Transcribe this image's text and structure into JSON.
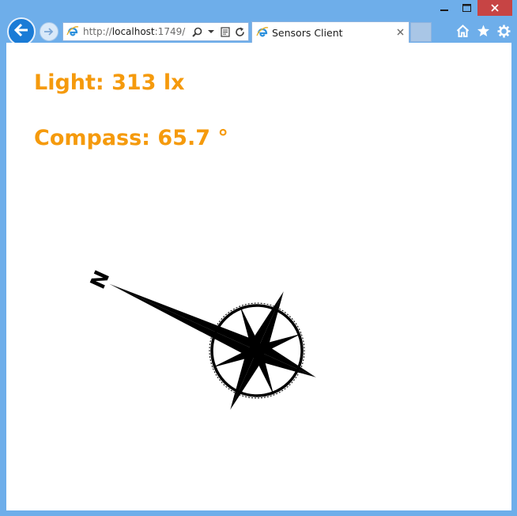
{
  "browser": {
    "address": {
      "scheme": "http://",
      "host": "localhost",
      "port": ":1749/"
    },
    "tab": {
      "title": "Sensors Client"
    },
    "icons": {
      "back": "back-arrow-icon",
      "forward": "forward-arrow-icon",
      "site": "ie-logo-icon",
      "search": "search-icon",
      "compatibility": "compatibility-view-icon",
      "refresh": "refresh-icon",
      "close_tab": "close-icon",
      "home": "home-icon",
      "favorites": "star-icon",
      "settings": "gear-icon"
    },
    "window_controls": [
      "minimize",
      "maximize",
      "close"
    ]
  },
  "page": {
    "light_label": "Light: 313 lx",
    "compass_label": "Compass: 65.7 °",
    "compass_rose": {
      "north_letter": "N",
      "heading_degrees": 65.7
    },
    "accent_color": "#f59a0c"
  }
}
